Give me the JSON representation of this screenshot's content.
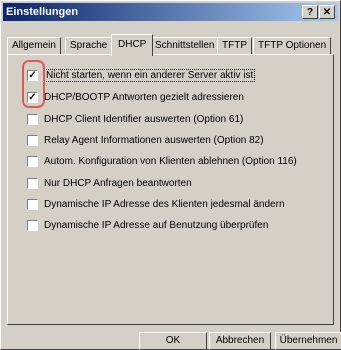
{
  "window": {
    "title": "Einstellungen",
    "help_glyph": "?",
    "close_glyph": "✕"
  },
  "tabs": [
    {
      "label": "Allgemein",
      "active": false
    },
    {
      "label": "Sprache",
      "active": false
    },
    {
      "label": "DHCP",
      "active": true
    },
    {
      "label": "Schnittstellen",
      "active": false
    },
    {
      "label": "TFTP",
      "active": false
    },
    {
      "label": "TFTP Optionen",
      "active": false
    }
  ],
  "options": [
    {
      "label": "Nicht starten, wenn ein anderer Server aktiv ist",
      "checked": true
    },
    {
      "label": "DHCP/BOOTP Antworten gezielt adressieren",
      "checked": true
    },
    {
      "label": "DHCP Client Identifier auswerten (Option 61)",
      "checked": false
    },
    {
      "label": "Relay Agent Informationen auswerten (Option 82)",
      "checked": false
    },
    {
      "label": "Autom. Konfiguration von Klienten ablehnen (Option 116)",
      "checked": false
    },
    {
      "label": "Nur DHCP Anfragen beantworten",
      "checked": false
    },
    {
      "label": "Dynamische IP Adresse des Klienten jedesmal ändern",
      "checked": false
    },
    {
      "label": "Dynamische IP Adresse auf Benutzung überprüfen",
      "checked": false
    }
  ],
  "checkmark": "✓",
  "buttons": {
    "ok": "OK",
    "cancel": "Abbrechen",
    "apply": "Übernehmen"
  },
  "colors": {
    "title_start": "#0a246a",
    "title_end": "#a6caf0",
    "highlight": "#e05a55",
    "face": "#d4d0c8"
  }
}
